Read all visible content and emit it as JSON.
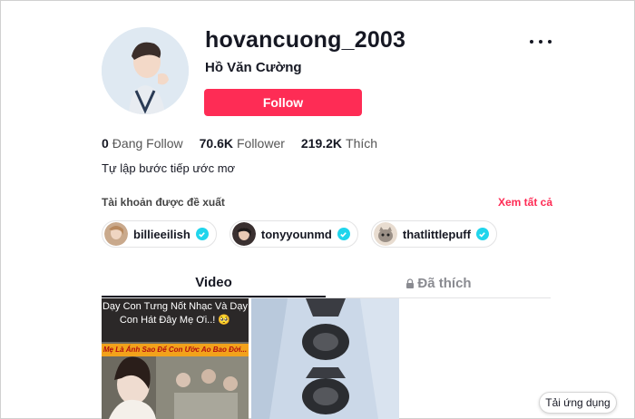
{
  "profile": {
    "username": "hovancuong_2003",
    "display_name": "Hồ Văn Cường",
    "follow_label": "Follow",
    "bio": "Tự lập bước tiếp ước mơ"
  },
  "stats": [
    {
      "value": "0",
      "label": "Đang Follow"
    },
    {
      "value": "70.6K",
      "label": "Follower"
    },
    {
      "value": "219.2K",
      "label": "Thích"
    }
  ],
  "suggested": {
    "title": "Tài khoản được đề xuất",
    "see_all": "Xem tất cả",
    "accounts": [
      {
        "name": "billieeilish",
        "verified": true
      },
      {
        "name": "tonyyounmd",
        "verified": true
      },
      {
        "name": "thatlittlepuff",
        "verified": true
      }
    ]
  },
  "tabs": {
    "video": "Video",
    "liked": "Đã thích"
  },
  "videos": {
    "first_caption": "Dạy Con Tưng Nốt Nhạc Và Dạy Con Hát Đây Mẹ Ơi..! 🥺",
    "first_band": "Mẹ Là Ánh Sao Để Con Ước Ao Bao Đời..."
  },
  "download_app": "Tải ứng dụng",
  "colors": {
    "accent": "#fe2c55",
    "verified": "#20d5ec"
  }
}
